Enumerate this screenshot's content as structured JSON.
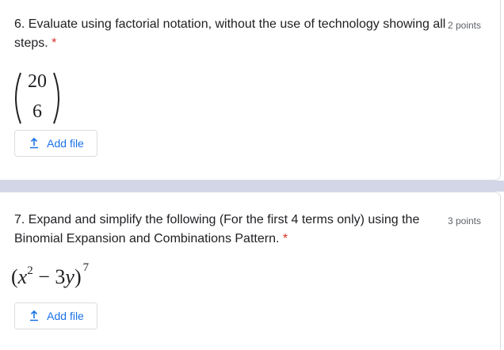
{
  "questions": [
    {
      "title": "6. Evaluate using factorial notation, without the use of technology showing all steps.",
      "required_mark": "*",
      "points": "2 points",
      "math": {
        "binom_top": "20",
        "binom_bottom": "6"
      },
      "add_file_label": "Add file"
    },
    {
      "title": "7. Expand and simplify the following (For the first 4 terms only) using the Binomial Expansion and Combinations Pattern.",
      "required_mark": "*",
      "points": "3 points",
      "math": {
        "x": "x",
        "x_exp": "2",
        "minus": "−",
        "coef": "3",
        "y": "y",
        "outer_exp": "7"
      },
      "add_file_label": "Add file"
    }
  ],
  "colors": {
    "accent": "#1a73e8",
    "required": "#d93025",
    "separator": "#d3d6e6"
  },
  "icons": {
    "add_file": "upload-icon"
  }
}
